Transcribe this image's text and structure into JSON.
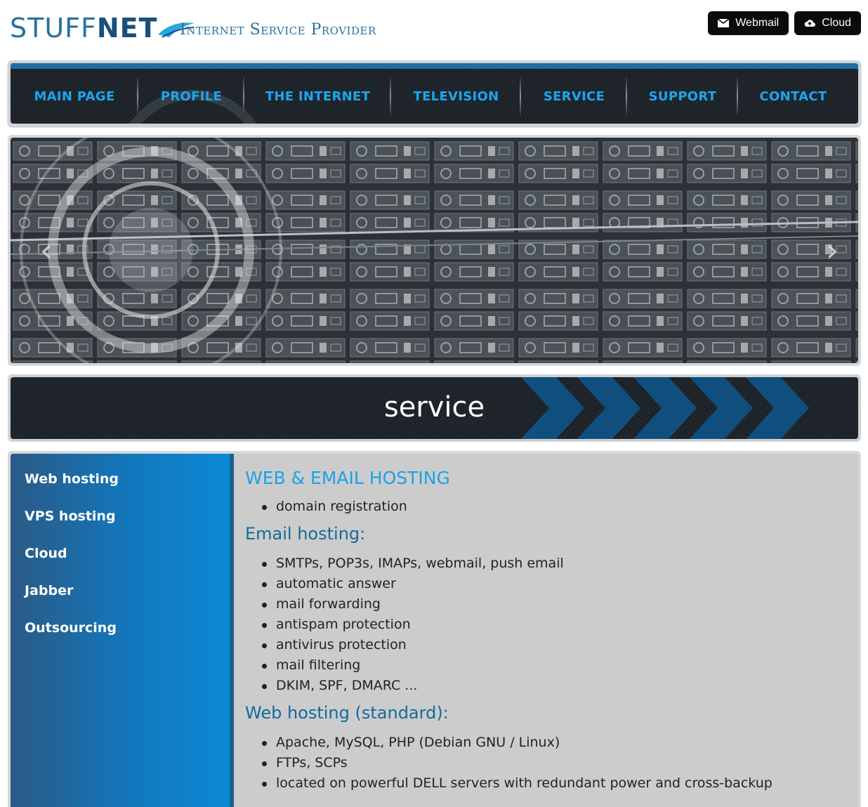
{
  "header": {
    "logo_text_light": "STUFF",
    "logo_text_bold": "NET",
    "tagline": "Internet Service Provider",
    "buttons": [
      {
        "label": "Webmail",
        "icon": "envelope-icon"
      },
      {
        "label": "Cloud",
        "icon": "cloud-upload-icon"
      }
    ]
  },
  "nav": {
    "items": [
      "MAIN PAGE",
      "PROFILE",
      "THE INTERNET",
      "TELEVISION",
      "SERVICE",
      "SUPPORT",
      "CONTACT"
    ]
  },
  "slider": {
    "prev_icon": "chevron-left-icon",
    "next_icon": "chevron-right-icon",
    "image": "server-rack-photo"
  },
  "banner": {
    "title": "service"
  },
  "sidebar": {
    "items": [
      "Web hosting",
      "VPS hosting",
      "Cloud",
      "Jabber",
      "Outsourcing"
    ]
  },
  "main": {
    "heading": "WEB & EMAIL HOSTING",
    "intro_items": [
      "domain registration"
    ],
    "sections": [
      {
        "title": "Email hosting:",
        "items": [
          "SMTPs, POP3s, IMAPs, webmail, push email",
          "automatic answer",
          "mail forwarding",
          "antispam protection",
          "antivirus protection",
          "mail filtering",
          "DKIM, SPF, DMARC ..."
        ]
      },
      {
        "title": "Web hosting (standard):",
        "items": [
          "Apache, MySQL, PHP (Debian GNU / Linux)",
          "FTPs, SCPs",
          "located on powerful DELL servers with redundant power and cross-backup"
        ]
      }
    ]
  },
  "colors": {
    "brand_blue": "#1e6fa5",
    "nav_text": "#19a7f0",
    "heading": "#18a3e8",
    "subheading": "#146a9c",
    "sidebar_blue": "#0a8ad6"
  }
}
